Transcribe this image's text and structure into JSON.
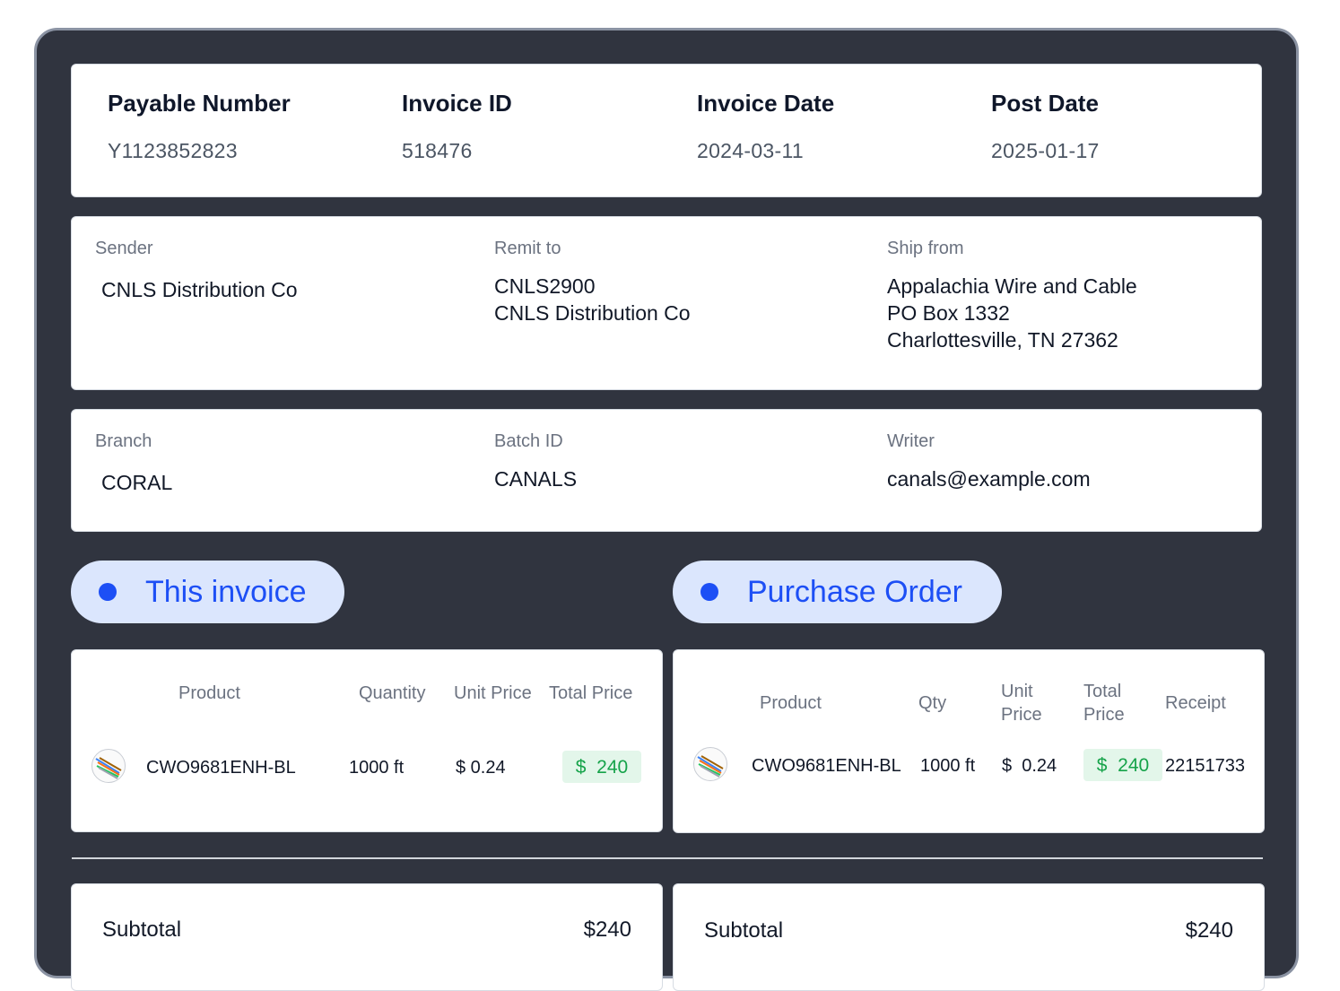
{
  "header": {
    "fields": [
      {
        "label": "Payable Number",
        "value": "Y1123852823"
      },
      {
        "label": "Invoice ID",
        "value": "518476"
      },
      {
        "label": "Invoice Date",
        "value": "2024-03-11"
      },
      {
        "label": "Post Date",
        "value": "2025-01-17"
      }
    ]
  },
  "parties": {
    "sender": {
      "label": "Sender",
      "value": "CNLS Distribution Co"
    },
    "remit_to": {
      "label": "Remit to",
      "value": "CNLS2900\nCNLS Distribution Co"
    },
    "ship_from": {
      "label": "Ship from",
      "value": "Appalachia Wire and Cable\nPO Box 1332\nCharlottesville, TN 27362"
    }
  },
  "meta": {
    "branch": {
      "label": "Branch",
      "value": "CORAL"
    },
    "batch_id": {
      "label": "Batch ID",
      "value": "CANALS"
    },
    "writer": {
      "label": "Writer",
      "value": "canals@example.com"
    }
  },
  "tabs": {
    "this_invoice": "This invoice",
    "purchase_order": "Purchase Order"
  },
  "invoice_table": {
    "columns": [
      "Product",
      "Quantity",
      "Unit Price",
      "Total Price"
    ],
    "rows": [
      {
        "product": "CWO9681ENH-BL",
        "quantity": "1000 ft",
        "unit_price": "$ 0.24",
        "total_price": "$  240",
        "icon": "cable-thumbnail-icon"
      }
    ]
  },
  "po_table": {
    "columns": [
      "Product",
      "Qty",
      "Unit\nPrice",
      "Total\nPrice",
      "Receipt"
    ],
    "rows": [
      {
        "product": "CWO9681ENH-BL",
        "quantity": "1000 ft",
        "unit_price": "$  0.24",
        "total_price": "$  240",
        "receipt": "22151733",
        "icon": "cable-thumbnail-icon"
      }
    ]
  },
  "totals": {
    "invoice": {
      "label": "Subtotal",
      "value": "$240"
    },
    "po": {
      "label": "Subtotal",
      "value": "$240"
    }
  },
  "colors": {
    "frame": "#30343f",
    "accent": "#1d4ff5",
    "pill_bg": "#dbe6fd",
    "badge_bg": "#e3f6ea",
    "badge_text": "#16a34a"
  }
}
